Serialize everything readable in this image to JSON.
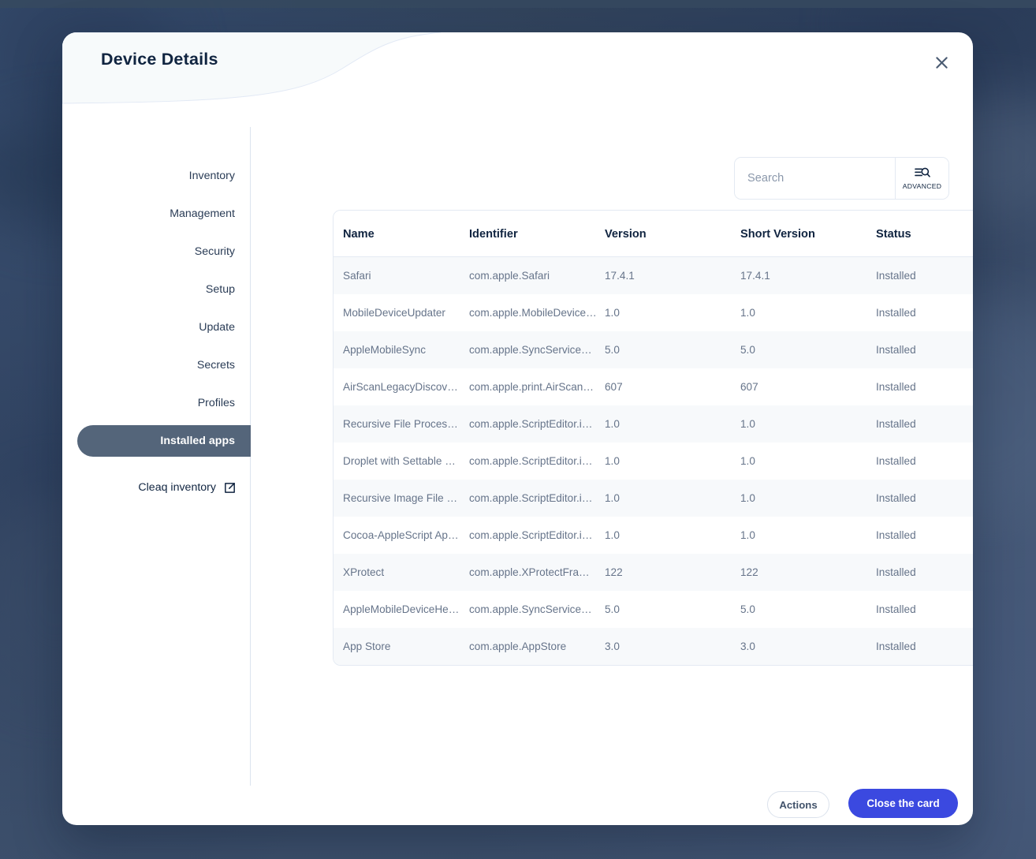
{
  "modal": {
    "title": "Device Details",
    "close_icon": "close-icon"
  },
  "sidebar": {
    "items": [
      {
        "label": "Inventory",
        "active": false
      },
      {
        "label": "Management",
        "active": false
      },
      {
        "label": "Security",
        "active": false
      },
      {
        "label": "Setup",
        "active": false
      },
      {
        "label": "Update",
        "active": false
      },
      {
        "label": "Secrets",
        "active": false
      },
      {
        "label": "Profiles",
        "active": false
      },
      {
        "label": "Installed apps",
        "active": true
      }
    ],
    "external_link": {
      "label": "Cleaq inventory",
      "icon": "external-link-icon"
    }
  },
  "search": {
    "placeholder": "Search",
    "value": "",
    "icon": "search-icon",
    "advanced_label": "ADVANCED",
    "advanced_icon": "filter-search-icon"
  },
  "table": {
    "columns": [
      "Name",
      "Identifier",
      "Version",
      "Short Version",
      "Status"
    ],
    "rows": [
      [
        "Safari",
        "com.apple.Safari",
        "17.4.1",
        "17.4.1",
        "Installed"
      ],
      [
        "MobileDeviceUpdater",
        "com.apple.MobileDeviceUpdater",
        "1.0",
        "1.0",
        "Installed"
      ],
      [
        "AppleMobileSync",
        "com.apple.SyncServices.AppleMobileSync",
        "5.0",
        "5.0",
        "Installed"
      ],
      [
        "AirScanLegacyDiscovery",
        "com.apple.print.AirScanLegacyDiscovery",
        "607",
        "607",
        "Installed"
      ],
      [
        "Recursive File Processing Droplet",
        "com.apple.ScriptEditor.id.Recursive-File-Processing-Droplet",
        "1.0",
        "1.0",
        "Installed"
      ],
      [
        "Droplet with Settable Properties",
        "com.apple.ScriptEditor.id.Droplet-with-Settable-Properties",
        "1.0",
        "1.0",
        "Installed"
      ],
      [
        "Recursive Image File Processing Droplet",
        "com.apple.ScriptEditor.id.Recursive-Image-File-Processing-Droplet",
        "1.0",
        "1.0",
        "Installed"
      ],
      [
        "Cocoa-AppleScript Applet",
        "com.apple.ScriptEditor.id.Cocoa-AppleScript-Applet",
        "1.0",
        "1.0",
        "Installed"
      ],
      [
        "XProtect",
        "com.apple.XProtectFramework",
        "122",
        "122",
        "Installed"
      ],
      [
        "AppleMobileDeviceHelper",
        "com.apple.SyncServices.AppleMobileDeviceHelper",
        "5.0",
        "5.0",
        "Installed"
      ],
      [
        "App Store",
        "com.apple.AppStore",
        "3.0",
        "3.0",
        "Installed"
      ]
    ]
  },
  "footer": {
    "actions_label": "Actions",
    "close_card_label": "Close the card"
  },
  "colors": {
    "accent": "#3b49e0",
    "sidebar_active": "#54657a",
    "title": "#102440",
    "backdrop": "#42546e"
  }
}
